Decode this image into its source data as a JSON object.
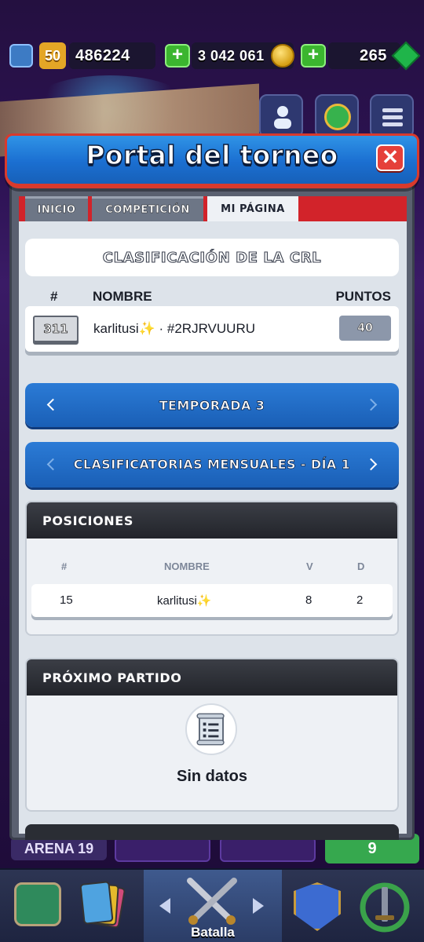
{
  "status": {
    "trophies": "486224",
    "level": "50",
    "gold": "3 042 061",
    "gems": "265",
    "plus_label": "+"
  },
  "modal": {
    "title": "Portal del torneo",
    "close_label": "✕"
  },
  "tabs": [
    {
      "label": "INICIO"
    },
    {
      "label": "COMPETICIÓN"
    },
    {
      "label": "MI PÁGINA"
    }
  ],
  "crl": {
    "title": "CLASIFICACIÓN DE LA CRL",
    "col_rank": "#",
    "col_name": "NOMBRE",
    "col_points": "PUNTOS",
    "row": {
      "rank": "311",
      "name": "karlitusi✨ · #2RJRVUURU",
      "points": "40"
    }
  },
  "season": {
    "label": "TEMPORADA 3"
  },
  "qualifier": {
    "label": "CLASIFICATORIAS MENSUALES - DÍA 1"
  },
  "positions": {
    "title": "POSICIONES",
    "col_rank": "#",
    "col_name": "NOMBRE",
    "col_wins": "V",
    "col_losses": "D",
    "row": {
      "rank": "15",
      "name": "karlitusi✨",
      "wins": "8",
      "losses": "2"
    }
  },
  "next_match": {
    "title": "PRÓXIMO PARTIDO",
    "empty_text": "Sin datos"
  },
  "background": {
    "arena_label": "ARENA 19",
    "green_tile_value": "9"
  },
  "nav": {
    "battle_label": "Batalla"
  },
  "colors": {
    "accent_blue": "#1b6fd1",
    "tab_red": "#d2232a",
    "close_red": "#e5403a"
  }
}
